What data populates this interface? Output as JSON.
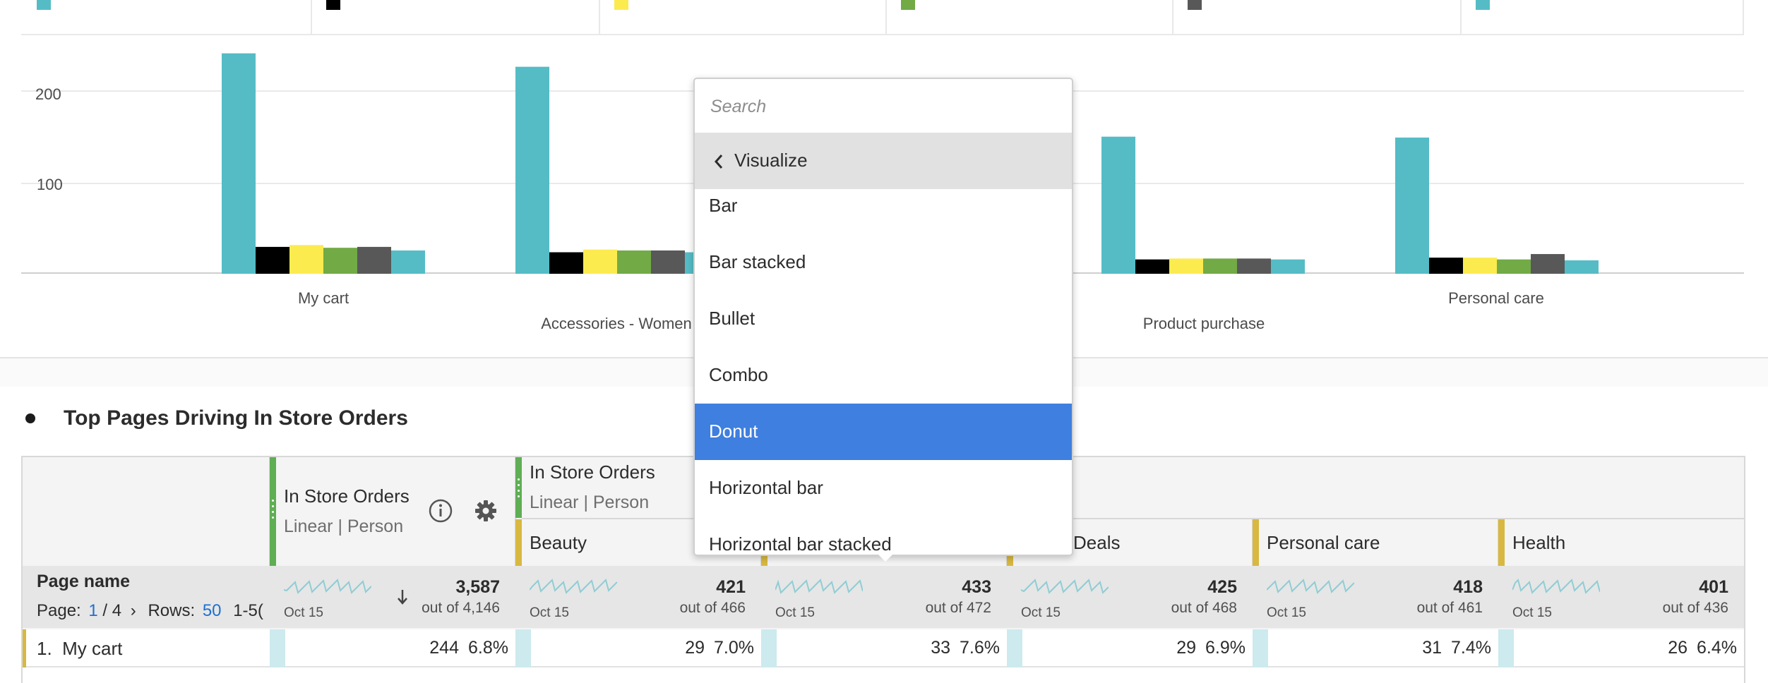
{
  "colors": {
    "teal": "#55bcc6",
    "black": "#000000",
    "yellow": "#fbeb4f",
    "green": "#72aa46",
    "gray": "#585858",
    "selected": "#3e7fdf",
    "grip_green": "#5fae54",
    "grip_yellow": "#d8b840"
  },
  "chart_data": {
    "type": "bar",
    "categories": [
      "My cart",
      "Accessories - Women",
      "",
      "Product purchase",
      "Personal care"
    ],
    "series": [
      {
        "color": "#55bcc6",
        "values": [
          246,
          231,
          null,
          153,
          152
        ]
      },
      {
        "color": "#000000",
        "values": [
          30,
          24,
          null,
          16,
          18
        ]
      },
      {
        "color": "#fbeb4f",
        "values": [
          32,
          27,
          null,
          17,
          18
        ]
      },
      {
        "color": "#72aa46",
        "values": [
          29,
          26,
          null,
          17,
          16
        ]
      },
      {
        "color": "#585858",
        "values": [
          30,
          26,
          null,
          17,
          22
        ]
      },
      {
        "color": "#55bcc6",
        "values": [
          26,
          24,
          null,
          16,
          15
        ]
      }
    ],
    "y_ticks": [
      "200",
      "100"
    ],
    "ylim": [
      0,
      260
    ],
    "legend_colors": [
      "#55bcc6",
      "#000000",
      "#fbeb4f",
      "#72aa46",
      "#585858",
      "#55bcc6"
    ]
  },
  "panel": {
    "title": "Top Pages Driving In Store Orders"
  },
  "table": {
    "metric_header": {
      "title": "In Store Orders",
      "sub": "Linear | Person"
    },
    "group_header": {
      "title": "In Store Orders",
      "sub": "Linear | Person"
    },
    "segments": [
      "Beauty",
      "",
      "Deals",
      "Personal care",
      "Health"
    ],
    "dimension": {
      "label": "Page name",
      "page_prefix": "Page:",
      "page_current": "1",
      "page_total": "/ 4",
      "rows_label": "Rows:",
      "rows_value": "50",
      "range": "1-5("
    },
    "summary": [
      {
        "total": "3,587",
        "outof": "out of 4,146",
        "date": "Oct 15"
      },
      {
        "total": "421",
        "outof": "out of 466",
        "date": "Oct 15"
      },
      {
        "total": "433",
        "outof": "out of 472",
        "date": "Oct 15"
      },
      {
        "total": "425",
        "outof": "out of 468",
        "date": "Oct 15"
      },
      {
        "total": "418",
        "outof": "out of 461",
        "date": "Oct 15"
      },
      {
        "total": "401",
        "outof": "out of 436",
        "date": "Oct 15"
      }
    ],
    "rows": [
      {
        "label": "1.  My cart",
        "cells": [
          {
            "value": "244",
            "pct": "6.8%"
          },
          {
            "value": "29",
            "pct": "7.0%"
          },
          {
            "value": "33",
            "pct": "7.6%"
          },
          {
            "value": "29",
            "pct": "6.9%"
          },
          {
            "value": "31",
            "pct": "7.4%"
          },
          {
            "value": "26",
            "pct": "6.4%"
          }
        ]
      }
    ]
  },
  "dropdown": {
    "search_placeholder": "Search",
    "back_label": "Visualize",
    "items": [
      "Bar",
      "Bar stacked",
      "Bullet",
      "Combo",
      "Donut",
      "Horizontal bar",
      "Horizontal bar stacked"
    ],
    "selected": "Donut"
  },
  "icons": {
    "info": "info-icon",
    "settings": "gear-icon",
    "sort": "sort-down-arrow-icon",
    "back": "chevron-left-icon",
    "next": "chevron-right-icon"
  }
}
